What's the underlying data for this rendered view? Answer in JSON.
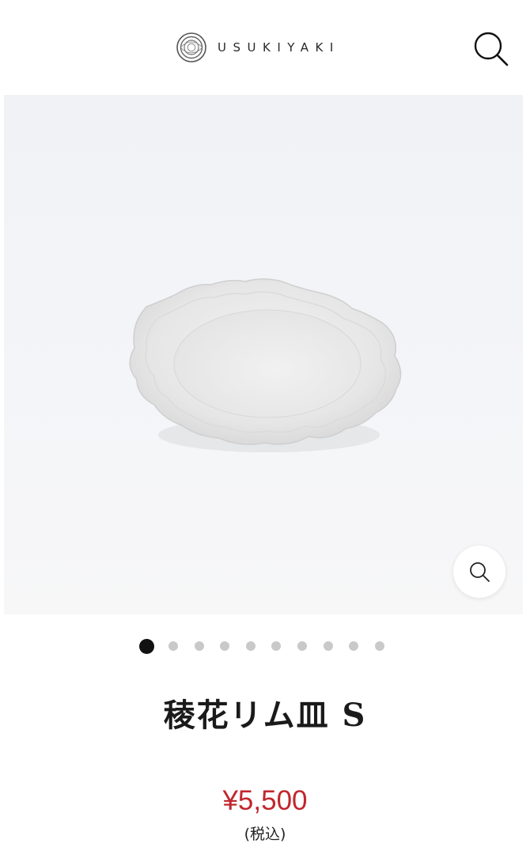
{
  "header": {
    "brand_name": "USUKIYAKI",
    "logo_icon": "ring-logo-icon",
    "search_icon": "search-icon"
  },
  "gallery": {
    "slide_count": 10,
    "active_index": 0,
    "zoom_icon": "zoom-magnifier-icon"
  },
  "product": {
    "title": "稜花リム皿 S",
    "price": "¥5,500",
    "tax_note": "(税込)"
  },
  "colors": {
    "price": "#c0272d",
    "active_dot": "#111111",
    "inactive_dot": "#c9c9c9"
  }
}
